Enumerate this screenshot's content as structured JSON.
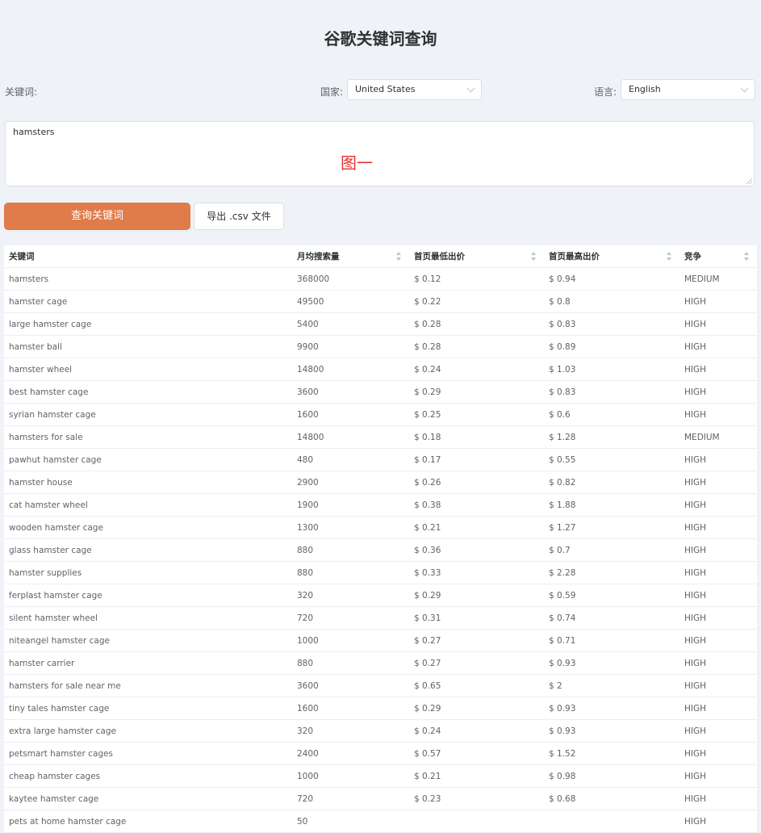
{
  "title": "谷歌关键词查询",
  "form": {
    "keyword_label": "关键词:",
    "country_label": "国家:",
    "country_value": "United States",
    "language_label": "语言:",
    "language_value": "English",
    "textarea_value": "hamsters",
    "watermark": "图一",
    "query_button": "查询关键词",
    "export_button": "导出 .csv 文件"
  },
  "table": {
    "columns": [
      "关键词",
      "月均搜索量",
      "首页最低出价",
      "首页最高出价",
      "竞争"
    ],
    "rows": [
      [
        "hamsters",
        "368000",
        "$ 0.12",
        "$ 0.94",
        "MEDIUM"
      ],
      [
        "hamster cage",
        "49500",
        "$ 0.22",
        "$ 0.8",
        "HIGH"
      ],
      [
        "large hamster cage",
        "5400",
        "$ 0.28",
        "$ 0.83",
        "HIGH"
      ],
      [
        "hamster ball",
        "9900",
        "$ 0.28",
        "$ 0.89",
        "HIGH"
      ],
      [
        "hamster wheel",
        "14800",
        "$ 0.24",
        "$ 1.03",
        "HIGH"
      ],
      [
        "best hamster cage",
        "3600",
        "$ 0.29",
        "$ 0.83",
        "HIGH"
      ],
      [
        "syrian hamster cage",
        "1600",
        "$ 0.25",
        "$ 0.6",
        "HIGH"
      ],
      [
        "hamsters for sale",
        "14800",
        "$ 0.18",
        "$ 1.28",
        "MEDIUM"
      ],
      [
        "pawhut hamster cage",
        "480",
        "$ 0.17",
        "$ 0.55",
        "HIGH"
      ],
      [
        "hamster house",
        "2900",
        "$ 0.26",
        "$ 0.82",
        "HIGH"
      ],
      [
        "cat hamster wheel",
        "1900",
        "$ 0.38",
        "$ 1.88",
        "HIGH"
      ],
      [
        "wooden hamster cage",
        "1300",
        "$ 0.21",
        "$ 1.27",
        "HIGH"
      ],
      [
        "glass hamster cage",
        "880",
        "$ 0.36",
        "$ 0.7",
        "HIGH"
      ],
      [
        "hamster supplies",
        "880",
        "$ 0.33",
        "$ 2.28",
        "HIGH"
      ],
      [
        "ferplast hamster cage",
        "320",
        "$ 0.29",
        "$ 0.59",
        "HIGH"
      ],
      [
        "silent hamster wheel",
        "720",
        "$ 0.31",
        "$ 0.74",
        "HIGH"
      ],
      [
        "niteangel hamster cage",
        "1000",
        "$ 0.27",
        "$ 0.71",
        "HIGH"
      ],
      [
        "hamster carrier",
        "880",
        "$ 0.27",
        "$ 0.93",
        "HIGH"
      ],
      [
        "hamsters for sale near me",
        "3600",
        "$ 0.65",
        "$ 2",
        "HIGH"
      ],
      [
        "tiny tales hamster cage",
        "1600",
        "$ 0.29",
        "$ 0.93",
        "HIGH"
      ],
      [
        "extra large hamster cage",
        "320",
        "$ 0.24",
        "$ 0.93",
        "HIGH"
      ],
      [
        "petsmart hamster cages",
        "2400",
        "$ 0.57",
        "$ 1.52",
        "HIGH"
      ],
      [
        "cheap hamster cages",
        "1000",
        "$ 0.21",
        "$ 0.98",
        "HIGH"
      ],
      [
        "kaytee hamster cage",
        "720",
        "$ 0.23",
        "$ 0.68",
        "HIGH"
      ],
      [
        "pets at home hamster cage",
        "50",
        "",
        "",
        "HIGH"
      ]
    ]
  },
  "colors": {
    "primary_button": "#e07b4a",
    "watermark": "#e8312f",
    "background": "#eff2f7"
  }
}
